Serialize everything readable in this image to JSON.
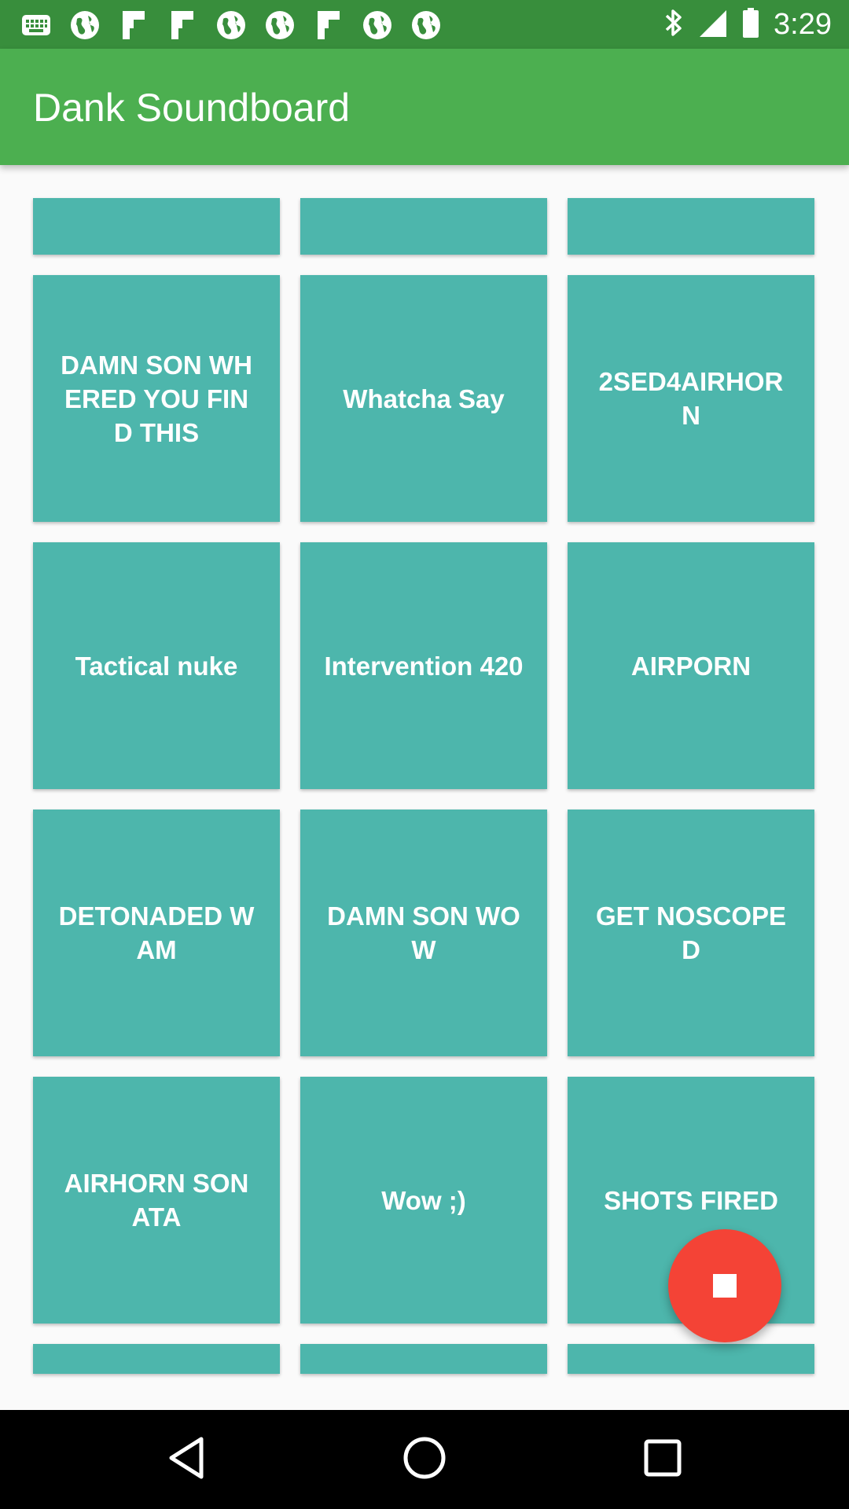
{
  "status_bar": {
    "time": "3:29",
    "notification_icons": [
      "chrome-icon",
      "globe-icon",
      "flipboard-icon",
      "flipboard-icon",
      "globe-icon",
      "globe-icon",
      "flipboard-icon",
      "globe-icon",
      "globe-icon"
    ],
    "right_icons": [
      "bluetooth-icon",
      "signal-icon",
      "battery-icon"
    ]
  },
  "app_bar": {
    "title": "Dank Soundboard"
  },
  "tiles": [
    {
      "label": ""
    },
    {
      "label": ""
    },
    {
      "label": ""
    },
    {
      "label": "DAMN SON WHERED YOU FIND THIS"
    },
    {
      "label": "Whatcha Say"
    },
    {
      "label": "2SED4AIRHORN"
    },
    {
      "label": "Tactical nuke"
    },
    {
      "label": "Intervention 420"
    },
    {
      "label": "AIRPORN"
    },
    {
      "label": "DETONADED WAM"
    },
    {
      "label": "DAMN SON WOW"
    },
    {
      "label": "GET NOSCOPED"
    },
    {
      "label": "AIRHORN SONATA"
    },
    {
      "label": "Wow ;)"
    },
    {
      "label": "SHOTS FIRED"
    },
    {
      "label": ""
    },
    {
      "label": ""
    },
    {
      "label": ""
    }
  ],
  "fab": {
    "icon": "stop-icon",
    "color": "#f44336"
  },
  "colors": {
    "primary": "#4caf50",
    "primary_dark": "#388e3c",
    "tile": "#4db6ac",
    "accent": "#f44336"
  },
  "nav_bar": {
    "buttons": [
      "back-icon",
      "home-icon",
      "recents-icon"
    ]
  }
}
